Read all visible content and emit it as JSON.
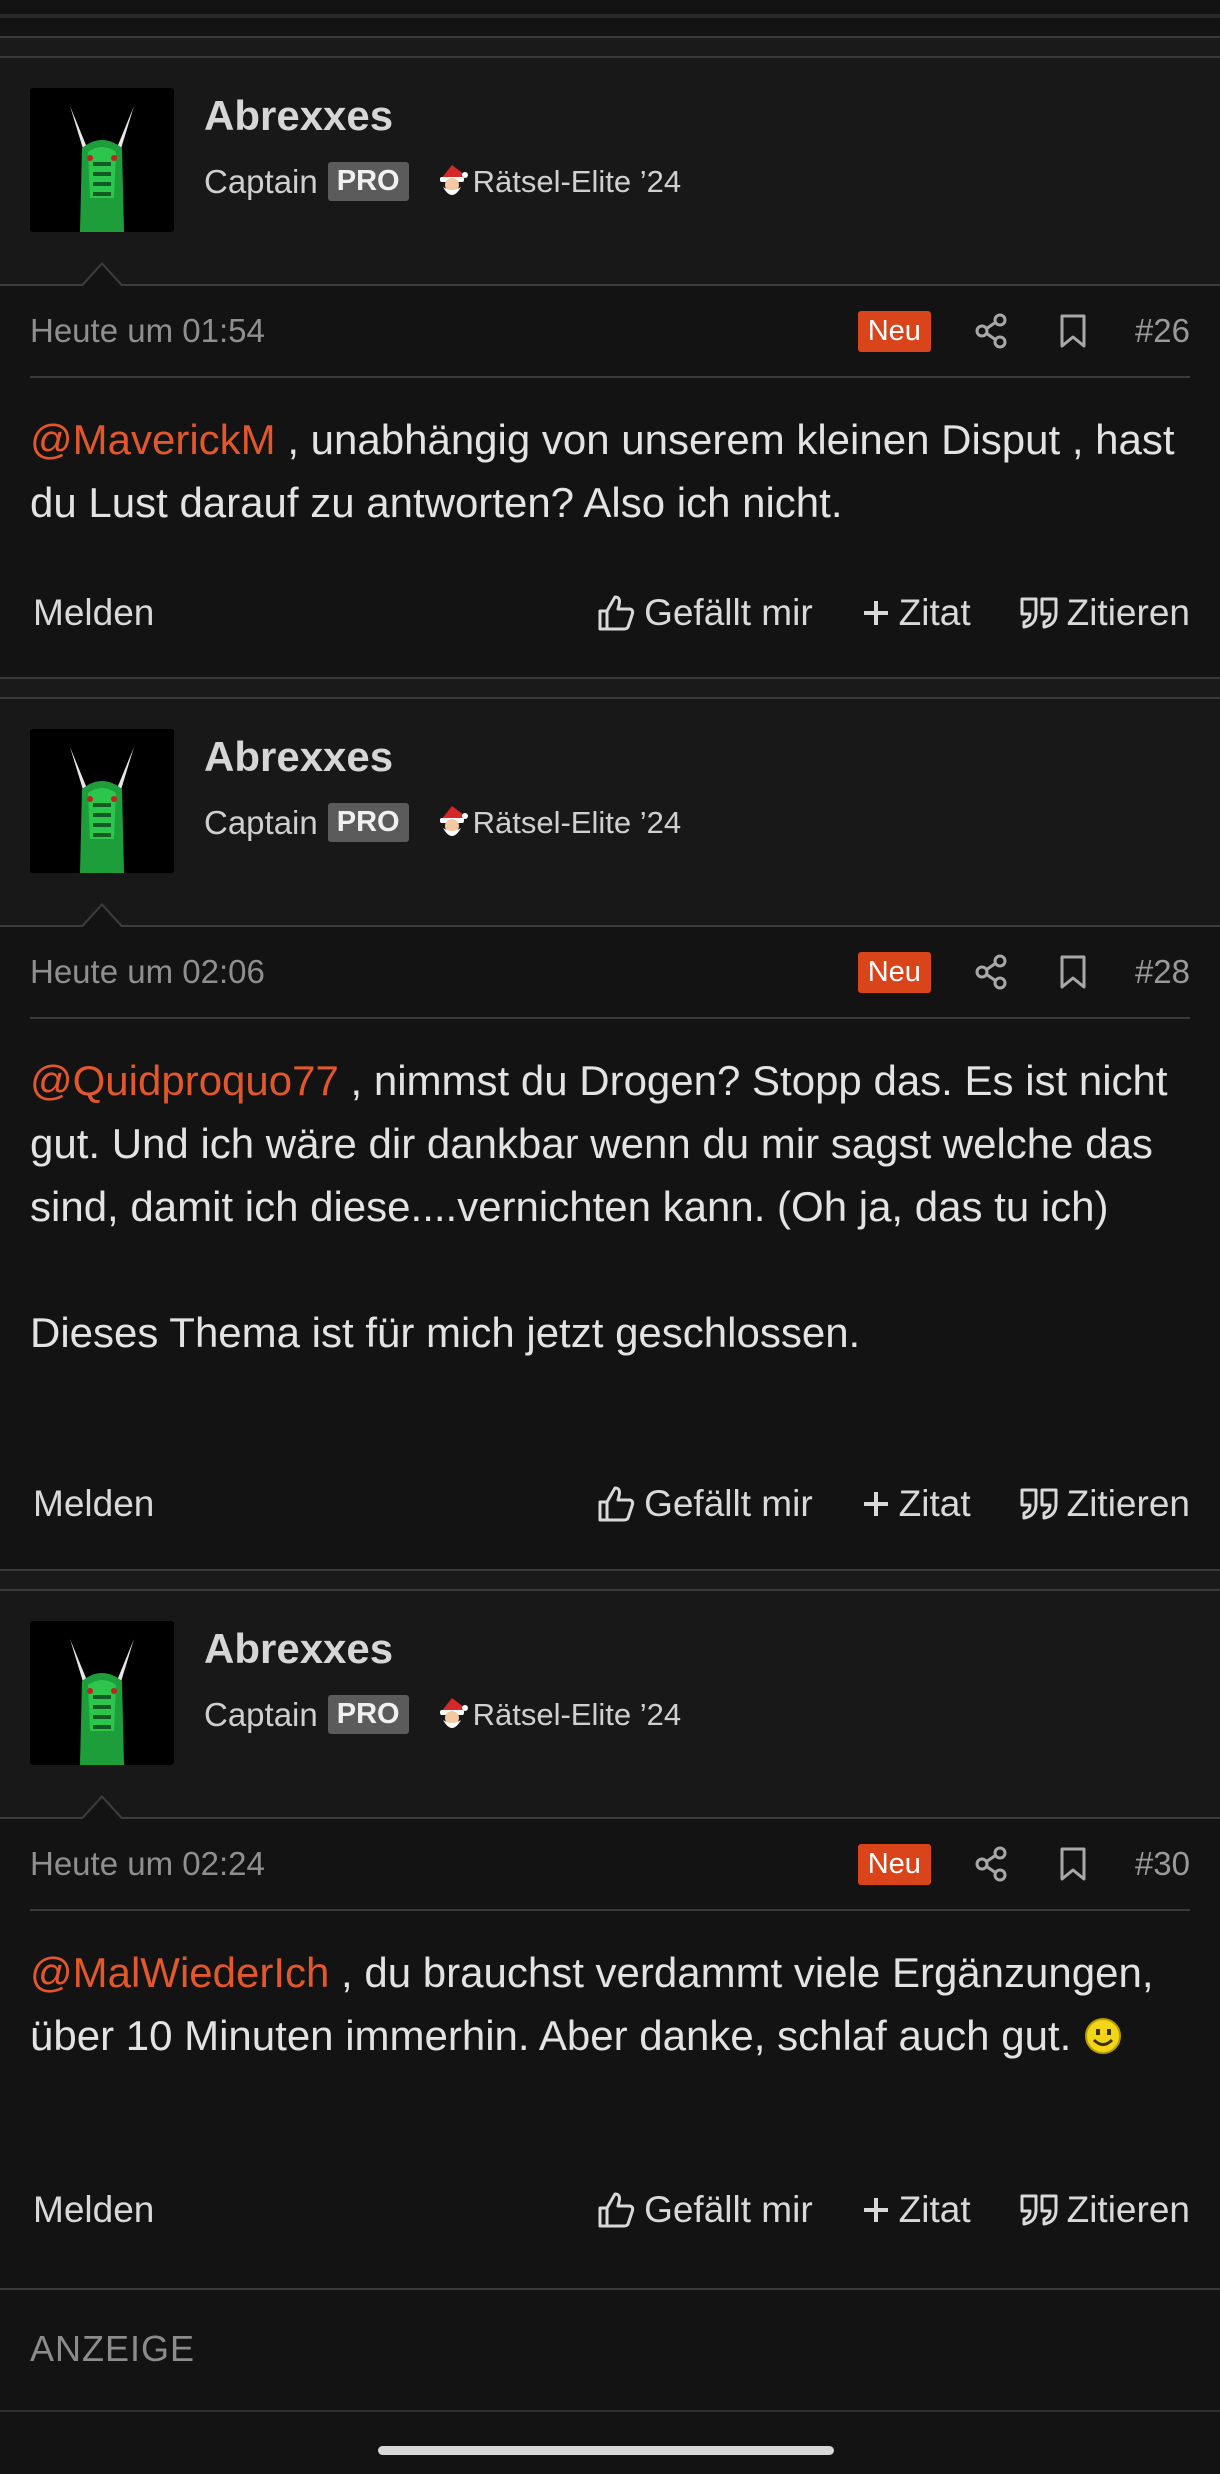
{
  "posts": [
    {
      "author": "Abrexxes",
      "rank": "Captain",
      "badge": "PRO",
      "award": "Rätsel-Elite ’24",
      "timestamp": "Heute um 01:54",
      "new_label": "Neu",
      "number": "#26",
      "mention": "@MaverickM",
      "text": " , unabhängig von unserem kleinen Disput , hast du Lust darauf zu antworten? Also ich nicht.",
      "text2": ""
    },
    {
      "author": "Abrexxes",
      "rank": "Captain",
      "badge": "PRO",
      "award": "Rätsel-Elite ’24",
      "timestamp": "Heute um 02:06",
      "new_label": "Neu",
      "number": "#28",
      "mention": "@Quidproquo77",
      "text": " , nimmst du Drogen? Stopp das. Es ist nicht gut. Und ich wäre dir dankbar wenn du mir sagst welche das sind, damit ich diese....vernichten kann. (Oh ja, das tu ich)",
      "text2": "Dieses Thema ist für mich jetzt geschlossen."
    },
    {
      "author": "Abrexxes",
      "rank": "Captain",
      "badge": "PRO",
      "award": "Rätsel-Elite ’24",
      "timestamp": "Heute um 02:24",
      "new_label": "Neu",
      "number": "#30",
      "mention": "@MalWiederIch",
      "text": " , du brauchst verdammt viele Ergänzungen, über 10 Minuten immerhin. Aber danke, schlaf auch gut. ",
      "text2": ""
    }
  ],
  "actions": {
    "report": "Melden",
    "like": "Gefällt mir",
    "quote_add": "Zitat",
    "quote": "Zitieren"
  },
  "ad": {
    "label": "ANZEIGE"
  },
  "icons": {
    "share": "share-icon",
    "bookmark": "bookmark-icon",
    "like": "thumbs-up-icon",
    "plus": "plus-icon",
    "quote": "quote-icon",
    "award": "santa-icon",
    "emoji": "smiley-icon"
  },
  "colors": {
    "accent": "#e2572b",
    "new_badge": "#d9441a",
    "background": "#131313",
    "header_background": "#181818"
  }
}
